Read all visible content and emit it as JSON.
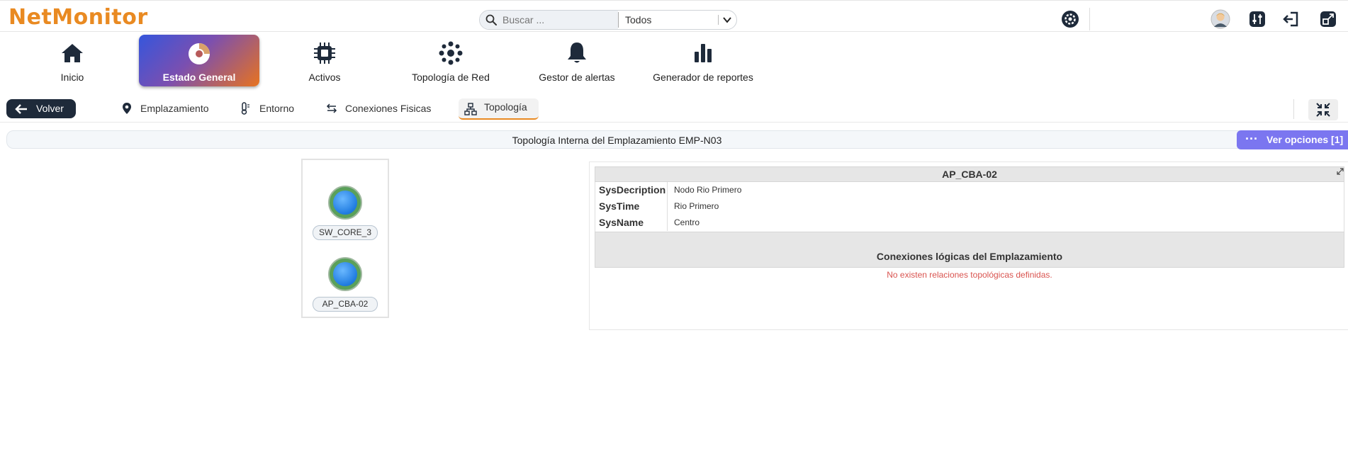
{
  "app": {
    "logo": "NetMonitor"
  },
  "search": {
    "placeholder": "Buscar ...",
    "scope": "Todos"
  },
  "nav": [
    {
      "label": "Inicio",
      "icon": "home-icon"
    },
    {
      "label": "Estado General",
      "icon": "dashboard-icon",
      "active": true
    },
    {
      "label": "Activos",
      "icon": "chip-icon"
    },
    {
      "label": "Topología de Red",
      "icon": "network-icon"
    },
    {
      "label": "Gestor de alertas",
      "icon": "bell-icon"
    },
    {
      "label": "Generador de reportes",
      "icon": "bar-chart-icon"
    }
  ],
  "subnav": {
    "back_label": "Volver",
    "tabs": [
      {
        "label": "Emplazamiento",
        "icon": "location-pin-icon"
      },
      {
        "label": "Entorno",
        "icon": "thermometer-icon"
      },
      {
        "label": "Conexiones Fisicas",
        "icon": "swap-arrows-icon"
      },
      {
        "label": "Topología",
        "icon": "sitemap-icon",
        "active": true
      }
    ]
  },
  "header": {
    "title": "Topología Interna del Emplazamiento EMP-N03",
    "options_label": "Ver opciones [1]"
  },
  "topology": {
    "nodes": [
      {
        "label": "SW_CORE_3"
      },
      {
        "label": "AP_CBA-02"
      }
    ]
  },
  "detail": {
    "title": "AP_CBA-02",
    "rows": [
      {
        "key": "SysDecription",
        "value": "Nodo Rio Primero"
      },
      {
        "key": "SysTime",
        "value": "Rio Primero"
      },
      {
        "key": "SysName",
        "value": "Centro"
      }
    ],
    "connections_title": "Conexiones lógicas del Emplazamiento",
    "empty_message": "No existen relaciones topológicas definidas."
  },
  "colors": {
    "brand": "#e98a22",
    "accent": "#7b76f0",
    "dark": "#1e2a3a",
    "error": "#d9534f"
  }
}
